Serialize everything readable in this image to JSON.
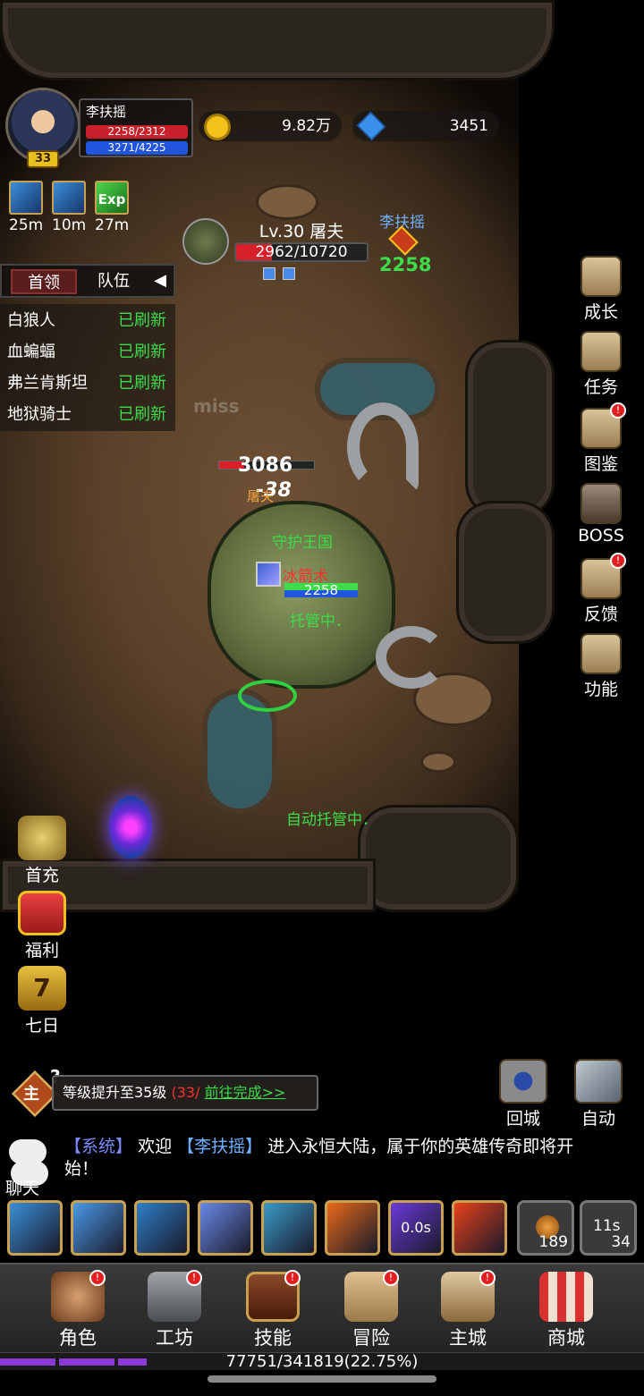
{
  "player": {
    "name": "李扶摇",
    "level": "33",
    "hp_text": "2258/2312",
    "mp_text": "3271/4225"
  },
  "currency": {
    "gold": "9.82万",
    "gems": "3451"
  },
  "buffs": [
    {
      "time": "25m"
    },
    {
      "time": "10m"
    },
    {
      "time": "27m",
      "label": "Exp"
    }
  ],
  "boss_panel": {
    "tab_boss": "首领",
    "tab_team": "队伍",
    "rows": [
      {
        "name": "白狼人",
        "status": "已刷新"
      },
      {
        "name": "血蝙蝠",
        "status": "已刷新"
      },
      {
        "name": "弗兰肯斯坦",
        "status": "已刷新"
      },
      {
        "name": "地狱骑士",
        "status": "已刷新"
      }
    ]
  },
  "enemy": {
    "name": "Lv.30 屠夫",
    "hp_text": "2962/10720",
    "hp_fraction": 0.276
  },
  "target": {
    "name": "李扶摇",
    "value": "2258"
  },
  "combat": {
    "miss": "miss",
    "damage": "3086",
    "float_damage": "-38",
    "butcher_label": "屠夫",
    "guild": "守护王国",
    "skill_name": "冰箭术",
    "mini_hp": "2258",
    "managed": "托管中．",
    "auto_message": "自动托管中．"
  },
  "right_menu": [
    {
      "label": "成长",
      "badge": false
    },
    {
      "label": "任务",
      "badge": false
    },
    {
      "label": "图鉴",
      "badge": true
    },
    {
      "label": "BOSS",
      "badge": false
    },
    {
      "label": "反馈",
      "badge": true
    },
    {
      "label": "功能",
      "badge": false
    }
  ],
  "left_menu": [
    {
      "label": "首充"
    },
    {
      "label": "福利"
    },
    {
      "label": "七日",
      "badge_number": "7"
    }
  ],
  "quest": {
    "badge": "主",
    "text": "等级提升至35级",
    "progress": "(33/",
    "go": "前往完成>>"
  },
  "actions": {
    "return": "回城",
    "auto": "自动"
  },
  "chat": {
    "label": "聊天",
    "system": "【系统】",
    "welcome": "欢迎",
    "player": "【李扶摇】",
    "message": "进入永恒大陆，属于你的英雄传奇即将开始！"
  },
  "skills": [
    {
      "name": "whirl",
      "color": "#3a8fd8"
    },
    {
      "name": "shatter",
      "color": "#4a9ae8"
    },
    {
      "name": "shield",
      "color": "#2e7fc8"
    },
    {
      "name": "comet",
      "color": "#6a8ae8"
    },
    {
      "name": "ice-lances",
      "color": "#3a9ac8"
    },
    {
      "name": "fireball",
      "color": "#e86a1a"
    },
    {
      "name": "arcane",
      "color": "#6a3ad8",
      "cooldown": "0.0s"
    },
    {
      "name": "fist",
      "color": "#e8401a"
    }
  ],
  "items": [
    {
      "count": "189"
    },
    {
      "cooldown": "11s",
      "count": "34"
    }
  ],
  "nav": [
    {
      "label": "角色"
    },
    {
      "label": "工坊"
    },
    {
      "label": "技能"
    },
    {
      "label": "冒险"
    },
    {
      "label": "主城"
    },
    {
      "label": "商城"
    }
  ],
  "xp": {
    "text": "77751/341819(22.75%)",
    "fraction": 0.2275
  }
}
